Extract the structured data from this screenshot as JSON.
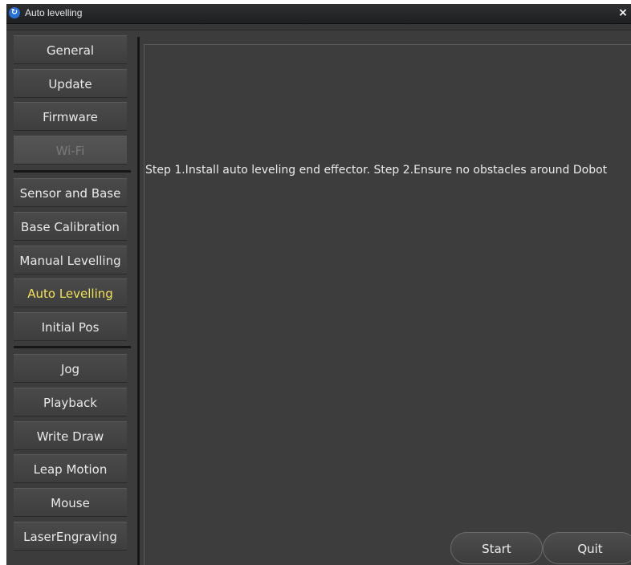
{
  "window": {
    "title": "Auto levelling",
    "close_glyph": "×"
  },
  "sidebar": {
    "group1": [
      {
        "label": "General",
        "state": "normal"
      },
      {
        "label": "Update",
        "state": "normal"
      },
      {
        "label": "Firmware",
        "state": "normal"
      },
      {
        "label": "Wi-Fi",
        "state": "disabled"
      }
    ],
    "group2": [
      {
        "label": "Sensor and Base",
        "state": "normal"
      },
      {
        "label": "Base Calibration",
        "state": "normal"
      },
      {
        "label": "Manual Levelling",
        "state": "normal"
      },
      {
        "label": "Auto Levelling",
        "state": "active"
      },
      {
        "label": "Initial Pos",
        "state": "normal"
      }
    ],
    "group3": [
      {
        "label": "Jog",
        "state": "normal"
      },
      {
        "label": "Playback",
        "state": "normal"
      },
      {
        "label": "Write  Draw",
        "state": "normal"
      },
      {
        "label": "Leap Motion",
        "state": "normal"
      },
      {
        "label": "Mouse",
        "state": "normal"
      },
      {
        "label": "LaserEngraving",
        "state": "normal"
      }
    ]
  },
  "main": {
    "instructions": "Step 1.Install auto leveling end effector. Step 2.Ensure no obstacles around Dobot",
    "start_label": "Start",
    "quit_label": "Quit"
  },
  "colors": {
    "active_text": "#f2e25a",
    "background": "#3c3c3c",
    "app_icon": "#2a6fd6"
  }
}
